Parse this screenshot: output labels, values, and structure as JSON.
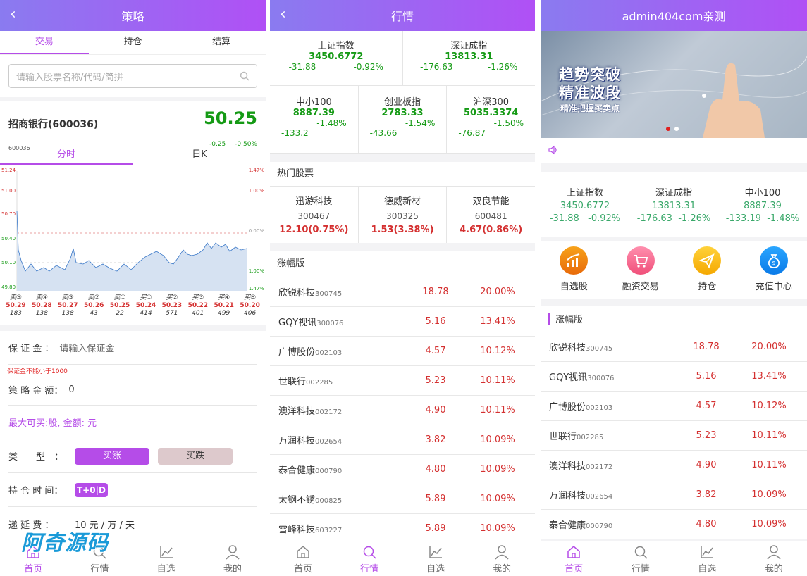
{
  "panel1": {
    "title": "策略",
    "tabs": [
      "交易",
      "持仓",
      "结算"
    ],
    "search_placeholder": "请输入股票名称/代码/简拼",
    "stock_name": "招商银行(600036)",
    "stock_price": "50.25",
    "stock_change": "-0.25",
    "stock_change_pct": "-0.50%",
    "stock_code": "600036",
    "chart_tabs": [
      "分时",
      "日K"
    ],
    "axis_left": [
      "51.24",
      "51.00",
      "50.70",
      "50.40",
      "50.10",
      "49.80"
    ],
    "axis_right": [
      "1.47%",
      "1.00%",
      "0.00%",
      "1.00%",
      "1.47%"
    ],
    "orderbook": [
      {
        "l": "卖⑤",
        "p": "50.29",
        "v": "183"
      },
      {
        "l": "卖④",
        "p": "50.28",
        "v": "138"
      },
      {
        "l": "卖③",
        "p": "50.27",
        "v": "138"
      },
      {
        "l": "卖②",
        "p": "50.26",
        "v": "43"
      },
      {
        "l": "卖①",
        "p": "50.25",
        "v": "22"
      },
      {
        "l": "买①",
        "p": "50.24",
        "v": "414"
      },
      {
        "l": "买②",
        "p": "50.23",
        "v": "571"
      },
      {
        "l": "买③",
        "p": "50.22",
        "v": "401"
      },
      {
        "l": "买④",
        "p": "50.21",
        "v": "499"
      },
      {
        "l": "买⑤",
        "p": "50.20",
        "v": "406"
      }
    ],
    "margin_label": "保 证 金 ：",
    "margin_placeholder": "请输入保证金",
    "margin_warning": "保证金不能小于1000",
    "amount_label": "策 略 金 额：",
    "amount_value": "0",
    "max_buy": "最大可买:股, 金额: 元",
    "type_label": "类　　型　：",
    "btn_up": "买涨",
    "btn_down": "买跌",
    "hold_label": "持 仓 时 间：",
    "hold_value": "T+0|D",
    "fee_label": "递 延 费 ：",
    "fee_value": "10 元 / 万 / 天",
    "watermark": "阿奇源码",
    "nav": [
      "首页",
      "行情",
      "自选",
      "我的"
    ]
  },
  "panel2": {
    "title": "行情",
    "indices_top": [
      {
        "name": "上证指数",
        "value": "3450.6772",
        "chg": "-31.88",
        "pct": "-0.92%"
      },
      {
        "name": "深证成指",
        "value": "13813.31",
        "chg": "-176.63",
        "pct": "-1.26%"
      }
    ],
    "indices_mid": [
      {
        "name": "中小100",
        "value": "8887.39",
        "pct": "-1.48%",
        "chg": "-133.2"
      },
      {
        "name": "创业板指",
        "value": "2783.33",
        "pct": "-1.54%",
        "chg": "-43.66"
      },
      {
        "name": "沪深300",
        "value": "5035.3374",
        "pct": "-1.50%",
        "chg": "-76.87"
      }
    ],
    "hot_title": "热门股票",
    "hot": [
      {
        "name": "迅游科技",
        "code": "300467",
        "price": "12.10(0.75%)"
      },
      {
        "name": "德威新材",
        "code": "300325",
        "price": "1.53(3.38%)"
      },
      {
        "name": "双良节能",
        "code": "600481",
        "price": "4.67(0.86%)"
      }
    ],
    "list_title": "涨幅版",
    "list": [
      {
        "name": "欣锐科技",
        "code": "300745",
        "price": "18.78",
        "pct": "20.00%"
      },
      {
        "name": "GQY视讯",
        "code": "300076",
        "price": "5.16",
        "pct": "13.41%"
      },
      {
        "name": "广博股份",
        "code": "002103",
        "price": "4.57",
        "pct": "10.12%"
      },
      {
        "name": "世联行",
        "code": "002285",
        "price": "5.23",
        "pct": "10.11%"
      },
      {
        "name": "澳洋科技",
        "code": "002172",
        "price": "4.90",
        "pct": "10.11%"
      },
      {
        "name": "万润科技",
        "code": "002654",
        "price": "3.82",
        "pct": "10.09%"
      },
      {
        "name": "泰合健康",
        "code": "000790",
        "price": "4.80",
        "pct": "10.09%"
      },
      {
        "name": "太钢不锈",
        "code": "000825",
        "price": "5.89",
        "pct": "10.09%"
      },
      {
        "name": "雪峰科技",
        "code": "603227",
        "price": "5.89",
        "pct": "10.09%"
      }
    ],
    "nav": [
      "首页",
      "行情",
      "自选",
      "我的"
    ]
  },
  "panel3": {
    "title": "admin404com亲测",
    "banner_line1": "趋势突破",
    "banner_line2": "精准波段",
    "banner_line3": "精准把握买卖点",
    "indices": [
      {
        "name": "上证指数",
        "value": "3450.6772",
        "chg": "-31.88",
        "pct": "-0.92%"
      },
      {
        "name": "深证成指",
        "value": "13813.31",
        "chg": "-176.63",
        "pct": "-1.26%"
      },
      {
        "name": "中小100",
        "value": "8887.39",
        "chg": "-133.19",
        "pct": "-1.48%"
      }
    ],
    "icons": [
      "自选股",
      "融资交易",
      "持仓",
      "充值中心"
    ],
    "list_title": "涨幅版",
    "list": [
      {
        "name": "欣锐科技",
        "code": "300745",
        "price": "18.78",
        "pct": "20.00%"
      },
      {
        "name": "GQY视讯",
        "code": "300076",
        "price": "5.16",
        "pct": "13.41%"
      },
      {
        "name": "广博股份",
        "code": "002103",
        "price": "4.57",
        "pct": "10.12%"
      },
      {
        "name": "世联行",
        "code": "002285",
        "price": "5.23",
        "pct": "10.11%"
      },
      {
        "name": "澳洋科技",
        "code": "002172",
        "price": "4.90",
        "pct": "10.11%"
      },
      {
        "name": "万润科技",
        "code": "002654",
        "price": "3.82",
        "pct": "10.09%"
      },
      {
        "name": "泰合健康",
        "code": "000790",
        "price": "4.80",
        "pct": "10.09%"
      }
    ],
    "nav": [
      "首页",
      "行情",
      "自选",
      "我的"
    ]
  },
  "colors": {
    "accent": "#b54ce8",
    "green": "#159a15",
    "red": "#d43030"
  }
}
